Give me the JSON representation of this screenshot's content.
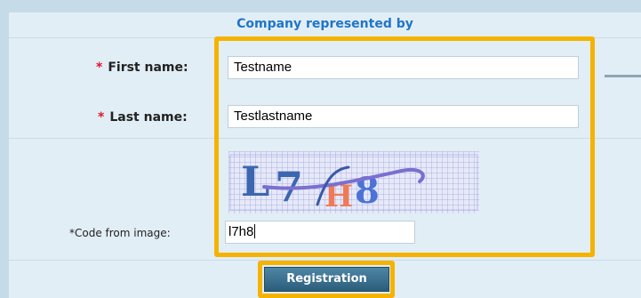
{
  "form": {
    "header": "Company represented by",
    "first_name": {
      "required_mark": "*",
      "label": "First name:",
      "value": "Testname"
    },
    "last_name": {
      "required_mark": "*",
      "label": "Last name:",
      "value": "Testlastname"
    },
    "captcha": {
      "image_text": "L7H8",
      "label": "*Code from image:",
      "value": "l7h8"
    },
    "submit_label": "Registration"
  },
  "colors": {
    "background": "#c5dbe8",
    "panel": "#e2eef6",
    "header_text": "#1f75c8",
    "required_star": "#e5142a",
    "highlight": "#f5b300",
    "button": "#2f6585"
  }
}
